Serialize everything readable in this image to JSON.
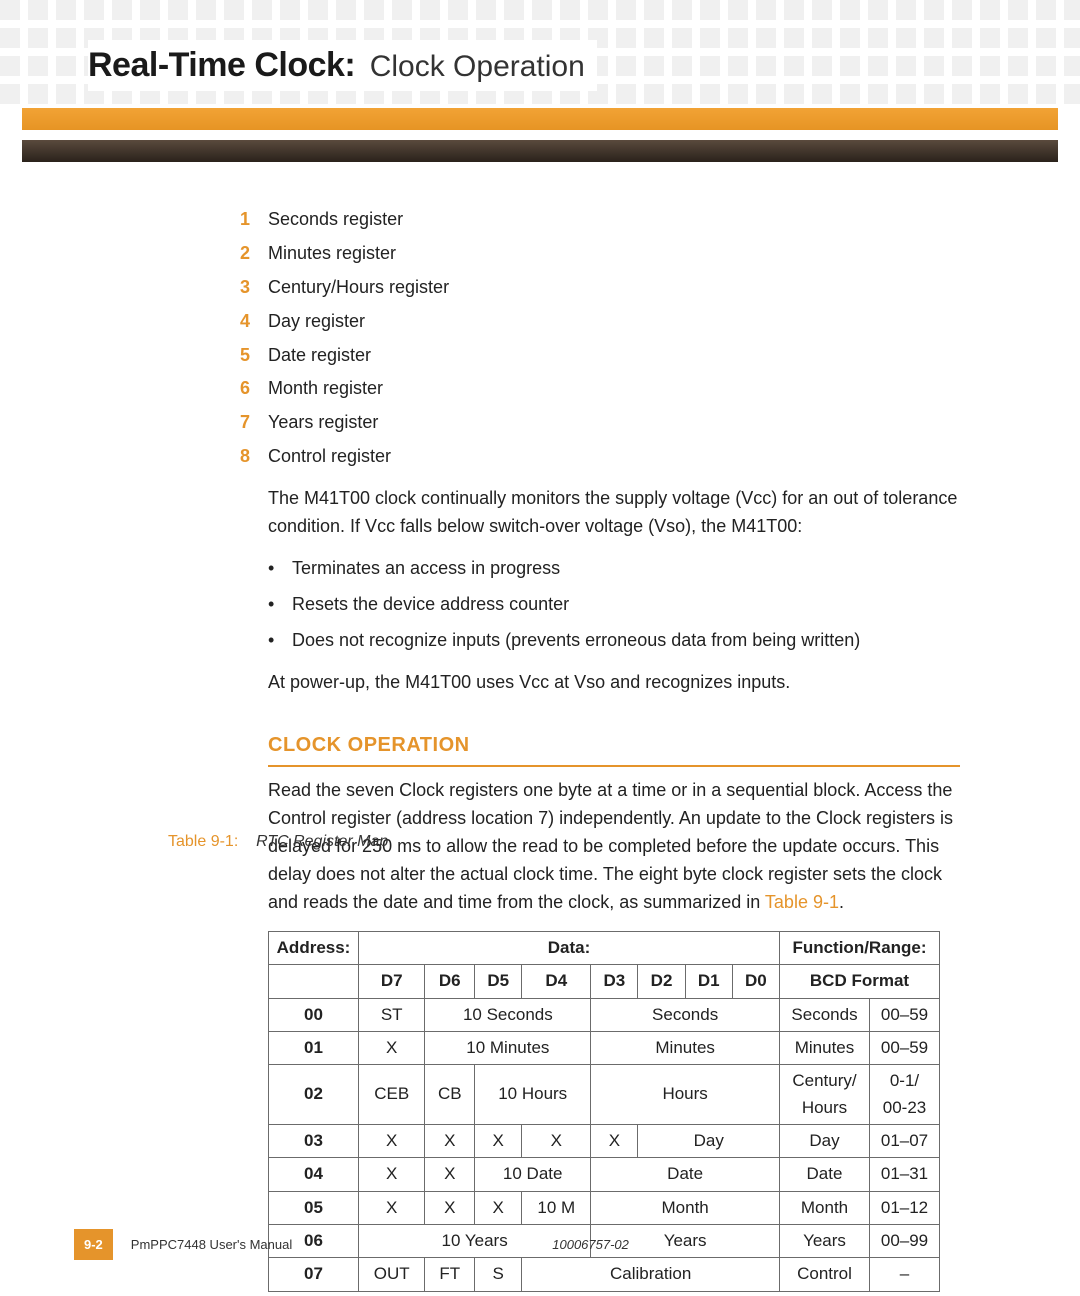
{
  "header": {
    "title_bold": "Real-Time Clock:",
    "title_light": "Clock Operation"
  },
  "registers_list": [
    "Seconds register",
    "Minutes register",
    "Century/Hours register",
    "Day register",
    "Date register",
    "Month register",
    "Years register",
    "Control register"
  ],
  "para1": "The M41T00 clock continually monitors the supply voltage (Vcc) for an out of tolerance condition. If Vcc falls below switch-over voltage (Vso), the M41T00:",
  "bullets": [
    "Terminates an access in progress",
    "Resets the device address counter",
    "Does not recognize inputs (prevents erroneous data from being written)"
  ],
  "para2": "At power-up, the M41T00 uses Vcc at Vso and recognizes inputs.",
  "section_heading": "CLOCK OPERATION",
  "section_para_a": "Read the seven Clock registers one byte at a time or in a sequential block. Access the Control register (address location 7) independently. An update to the Clock registers is delayed for 250 ms to allow the read to be completed before the update occurs. This delay does not alter the actual clock time. The eight byte clock register sets the clock and reads the date and time from the clock, as summarized in ",
  "section_para_ref": "Table 9-1",
  "section_para_b": ".",
  "table_caption_lead": "Table 9-1:",
  "table_caption_title": "RTC Register Map",
  "table": {
    "head_address": "Address:",
    "head_data": "Data:",
    "head_func": "Function/Range:",
    "bits": [
      "D7",
      "D6",
      "D5",
      "D4",
      "D3",
      "D2",
      "D1",
      "D0"
    ],
    "head_bcd": "BCD Format",
    "rows": [
      {
        "addr": "00",
        "cells": [
          {
            "t": "ST",
            "s": 1
          },
          {
            "t": "10 Seconds",
            "s": 3
          },
          {
            "t": "Seconds",
            "s": 4
          }
        ],
        "func": "Seconds",
        "range": "00–59"
      },
      {
        "addr": "01",
        "cells": [
          {
            "t": "X",
            "s": 1
          },
          {
            "t": "10 Minutes",
            "s": 3
          },
          {
            "t": "Minutes",
            "s": 4
          }
        ],
        "func": "Minutes",
        "range": "00–59"
      },
      {
        "addr": "02",
        "cells": [
          {
            "t": "CEB",
            "s": 1
          },
          {
            "t": "CB",
            "s": 1
          },
          {
            "t": "10 Hours",
            "s": 2
          },
          {
            "t": "Hours",
            "s": 4
          }
        ],
        "func": "Century/\nHours",
        "range": "0-1/\n00-23"
      },
      {
        "addr": "03",
        "cells": [
          {
            "t": "X",
            "s": 1
          },
          {
            "t": "X",
            "s": 1
          },
          {
            "t": "X",
            "s": 1
          },
          {
            "t": "X",
            "s": 1
          },
          {
            "t": "X",
            "s": 1
          },
          {
            "t": "Day",
            "s": 3
          }
        ],
        "func": "Day",
        "range": "01–07"
      },
      {
        "addr": "04",
        "cells": [
          {
            "t": "X",
            "s": 1
          },
          {
            "t": "X",
            "s": 1
          },
          {
            "t": "10 Date",
            "s": 2
          },
          {
            "t": "Date",
            "s": 4
          }
        ],
        "func": "Date",
        "range": "01–31"
      },
      {
        "addr": "05",
        "cells": [
          {
            "t": "X",
            "s": 1
          },
          {
            "t": "X",
            "s": 1
          },
          {
            "t": "X",
            "s": 1
          },
          {
            "t": "10 M",
            "s": 1
          },
          {
            "t": "Month",
            "s": 4
          }
        ],
        "func": "Month",
        "range": "01–12"
      },
      {
        "addr": "06",
        "cells": [
          {
            "t": "10 Years",
            "s": 4
          },
          {
            "t": "Years",
            "s": 4
          }
        ],
        "func": "Years",
        "range": "00–99"
      },
      {
        "addr": "07",
        "cells": [
          {
            "t": "OUT",
            "s": 1
          },
          {
            "t": "FT",
            "s": 1
          },
          {
            "t": "S",
            "s": 1
          },
          {
            "t": "Calibration",
            "s": 5
          }
        ],
        "func": "Control",
        "range": "–"
      }
    ]
  },
  "footer": {
    "page": "9-2",
    "manual": "PmPPC7448 User's Manual",
    "docnum": "10006757-02"
  }
}
